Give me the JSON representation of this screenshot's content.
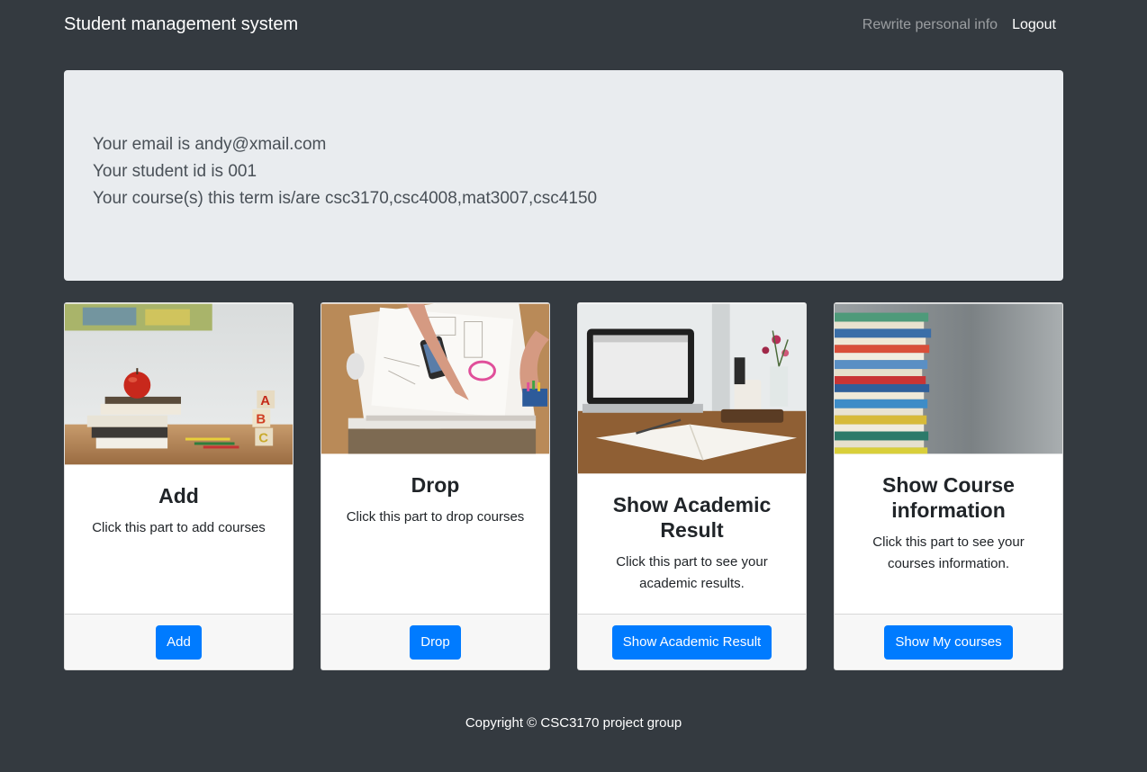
{
  "navbar": {
    "brand": "Student management system",
    "rewrite_label": "Rewrite personal info",
    "logout_label": "Logout"
  },
  "info": {
    "email_line": "Your email is andy@xmail.com",
    "id_line": "Your student id is 001",
    "courses_line": "Your course(s) this term is/are csc3170,csc4008,mat3007,csc4150"
  },
  "cards": [
    {
      "title": "Add",
      "text": "Click this part to add courses",
      "button": "Add",
      "image": "apple-books-photo"
    },
    {
      "title": "Drop",
      "text": "Click this part to drop courses",
      "button": "Drop",
      "image": "desk-drawing-photo"
    },
    {
      "title": "Show Academic Result",
      "text": "Click this part to see your academic results.",
      "button": "Show Academic Result",
      "image": "laptop-notebook-photo"
    },
    {
      "title": "Show Course information",
      "text": "Click this part to see your courses information.",
      "button": "Show My courses",
      "image": "book-stack-photo"
    }
  ],
  "footer": {
    "copyright": "Copyright © CSC3170 project group"
  },
  "colors": {
    "background": "#343a40",
    "primary": "#007bff",
    "jumbotron": "#e9ecef"
  }
}
